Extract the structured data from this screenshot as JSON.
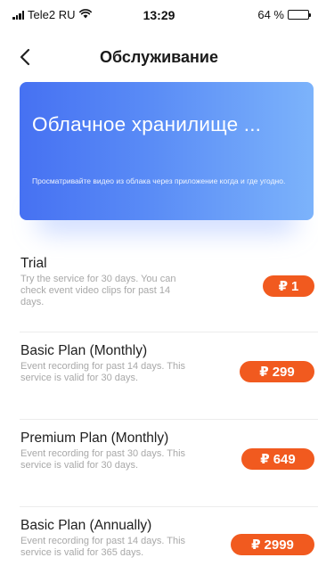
{
  "status_bar": {
    "carrier": "Tele2 RU",
    "time": "13:29",
    "battery": "64 %",
    "battery_level": 0.64
  },
  "nav": {
    "title": "Обслуживание"
  },
  "banner": {
    "title": "Облачное хранилище ...",
    "description": "Просматривайте видео из облака через приложение когда и где угодно."
  },
  "plans": [
    {
      "name": "Trial",
      "description": "Try the service for 30 days. You can check event video clips for past 14 days.",
      "currency": "₽",
      "price": "1"
    },
    {
      "name": "Basic Plan (Monthly)",
      "description": "Event recording for past 14 days. This service is valid for 30 days.",
      "currency": "₽",
      "price": "299"
    },
    {
      "name": "Premium Plan (Monthly)",
      "description": "Event recording for past 30 days. This service is valid for 30 days.",
      "currency": "₽",
      "price": "649"
    },
    {
      "name": "Basic Plan (Annually)",
      "description": "Event recording for past 14 days. This service is valid for 365 days.",
      "currency": "₽",
      "price": "2999"
    }
  ],
  "colors": {
    "accent": "#f15a1f",
    "banner_start": "#4671f2",
    "banner_end": "#7cb3fb"
  }
}
